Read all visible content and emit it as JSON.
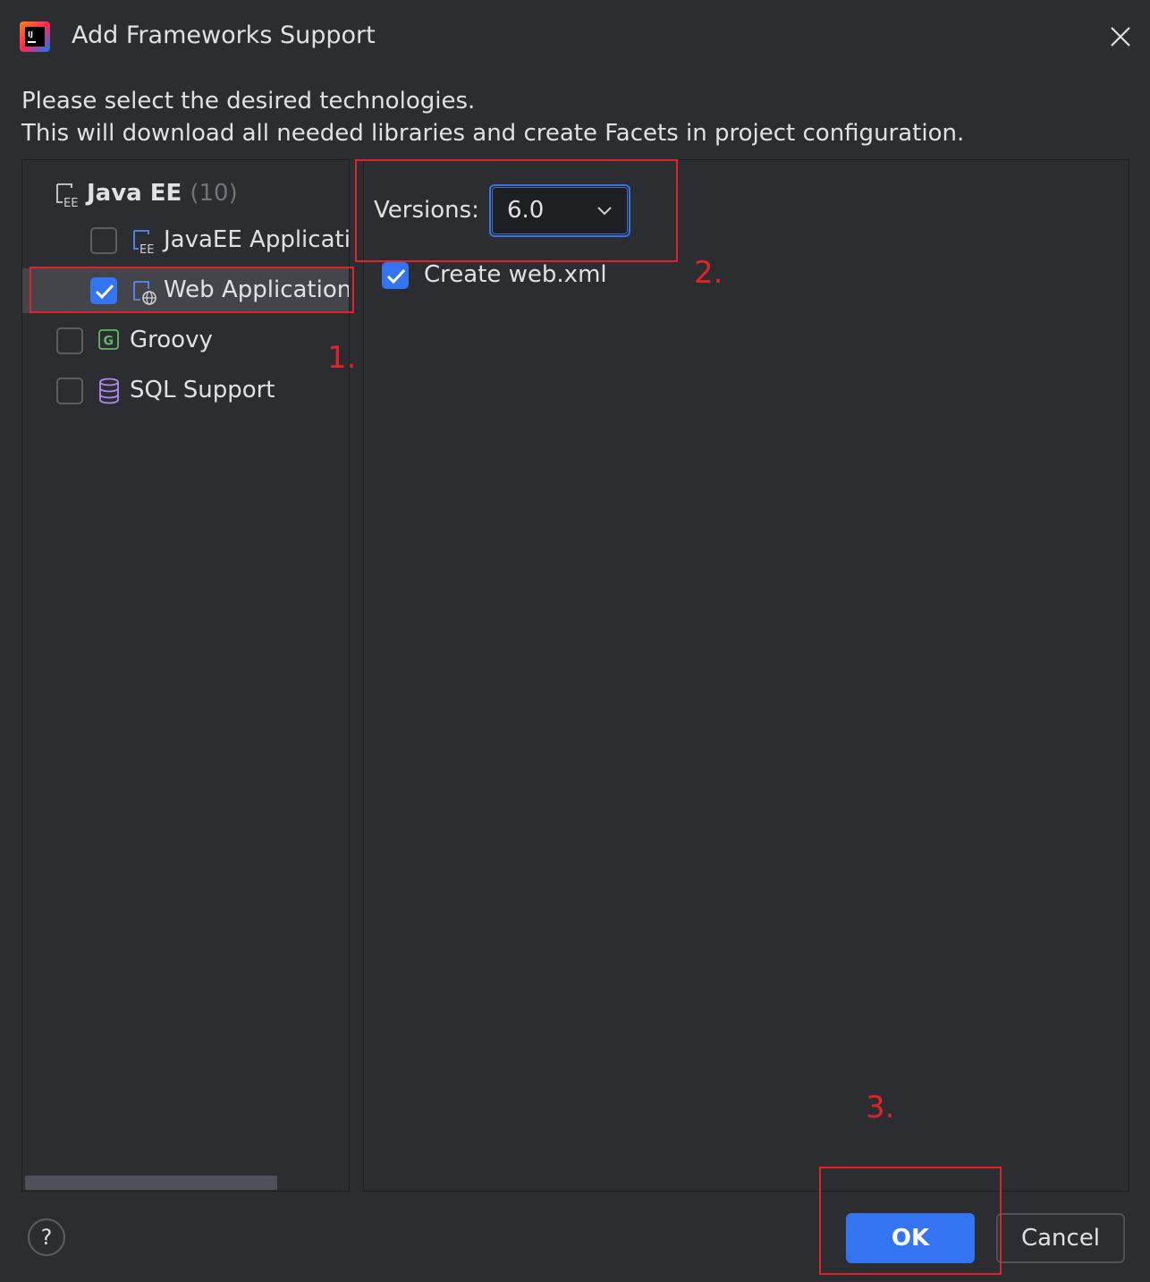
{
  "window": {
    "title": "Add Frameworks Support",
    "close_icon": "close-icon"
  },
  "description": {
    "line1": "Please select the desired technologies.",
    "line2": "This will download all needed libraries and create Facets in project configuration."
  },
  "tree": {
    "group": {
      "label": "Java EE",
      "count": "(10)",
      "icon": "javaee-icon"
    },
    "items": [
      {
        "label": "JavaEE Applicatio",
        "checked": false,
        "icon": "javaee-app-icon"
      },
      {
        "label": "Web Application",
        "checked": true,
        "icon": "web-app-icon",
        "selected": true
      },
      {
        "label": "Groovy",
        "checked": false,
        "icon": "groovy-icon"
      },
      {
        "label": "SQL Support",
        "checked": false,
        "icon": "database-icon"
      }
    ]
  },
  "details": {
    "versions_label": "Versions:",
    "version_selected": "6.0",
    "create_webxml_label": "Create web.xml",
    "create_webxml_checked": true
  },
  "footer": {
    "help_label": "?",
    "ok_label": "OK",
    "cancel_label": "Cancel"
  },
  "annotations": {
    "step1": "1.",
    "step2": "2.",
    "step3": "3."
  },
  "colors": {
    "background": "#2b2d30",
    "accent": "#3574f0",
    "annotation": "#e0222a",
    "text": "#dfe1e5"
  }
}
